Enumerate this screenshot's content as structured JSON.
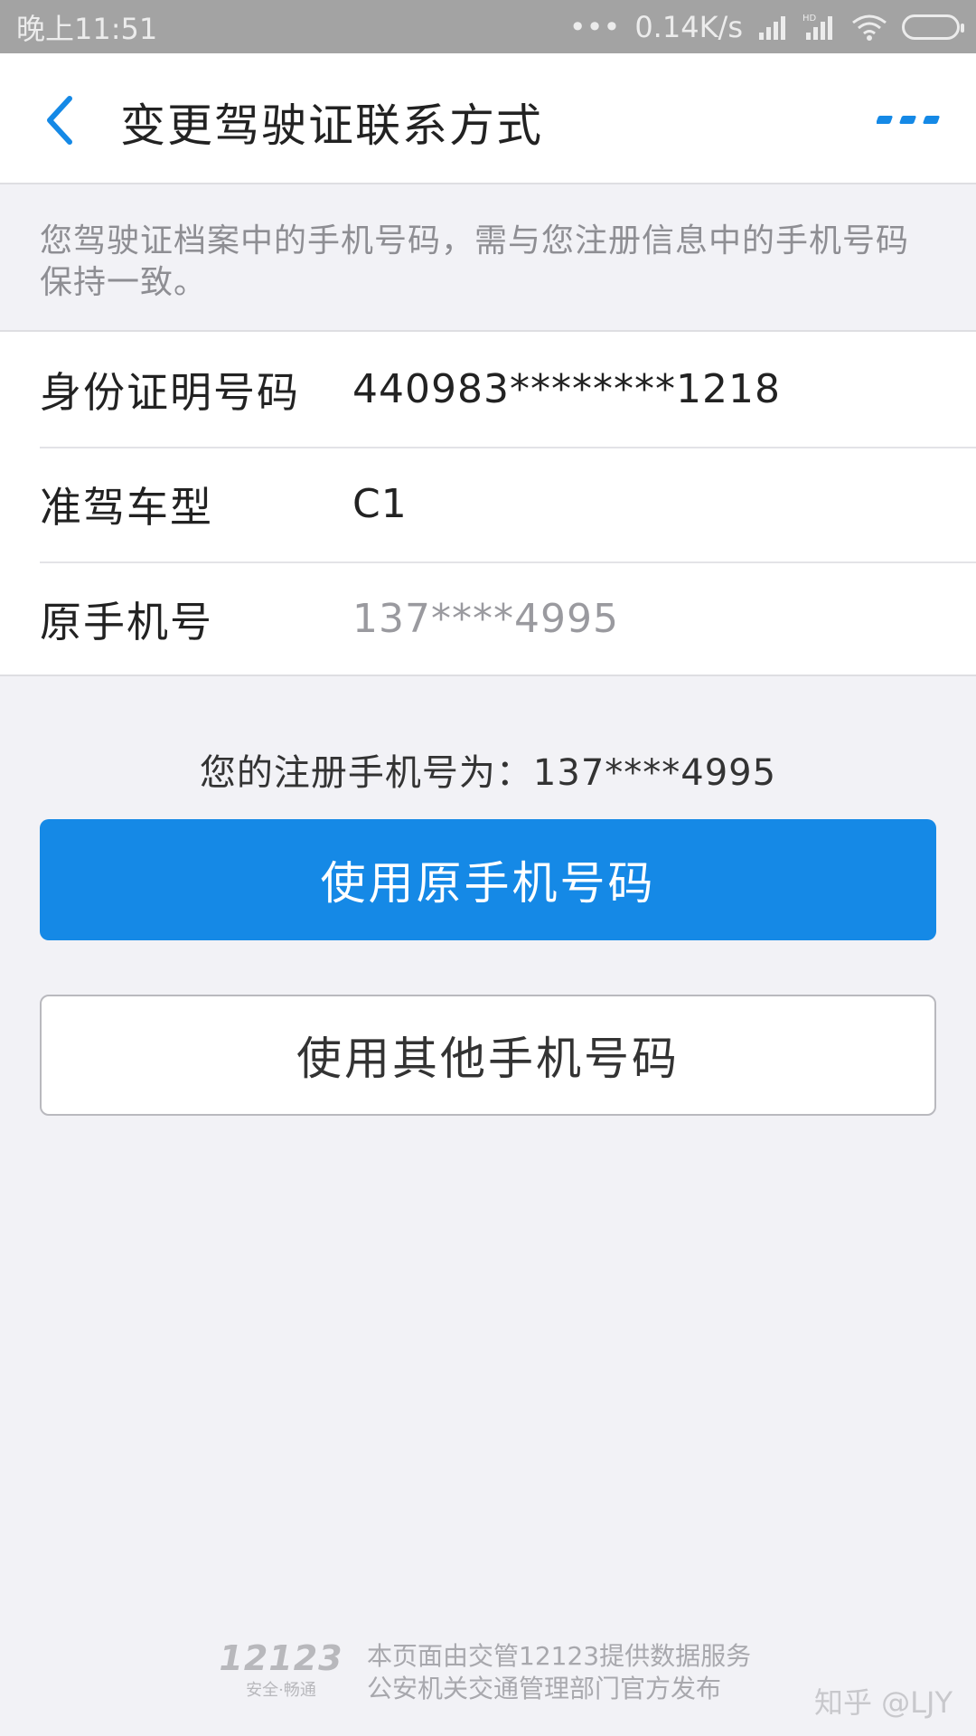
{
  "statusbar": {
    "time": "晚上11:51",
    "net_speed": "0.14K/s",
    "dots": "•••",
    "hd_label": "HD"
  },
  "navbar": {
    "title": "变更驾驶证联系方式",
    "back_icon": "chevron-left-icon",
    "more_icon": "more-dots-icon",
    "accent": "#1589e6"
  },
  "notice": {
    "text": "您驾驶证档案中的手机号码，需与您注册信息中的手机号码保持一致。"
  },
  "info": {
    "rows": [
      {
        "label": "身份证明号码",
        "value": "440983********1218"
      },
      {
        "label": "准驾车型",
        "value": "C1"
      },
      {
        "label": "原手机号",
        "value": "137****4995"
      }
    ]
  },
  "registered": {
    "text": "您的注册手机号为：137****4995"
  },
  "buttons": {
    "use_original": "使用原手机号码",
    "use_other": "使用其他手机号码"
  },
  "footer": {
    "logo_number": "12123",
    "logo_slogan": "安全·畅通",
    "line1": "本页面由交管12123提供数据服务",
    "line2": "公安机关交通管理部门官方发布"
  },
  "watermark": {
    "text": "知乎 @LJY"
  }
}
